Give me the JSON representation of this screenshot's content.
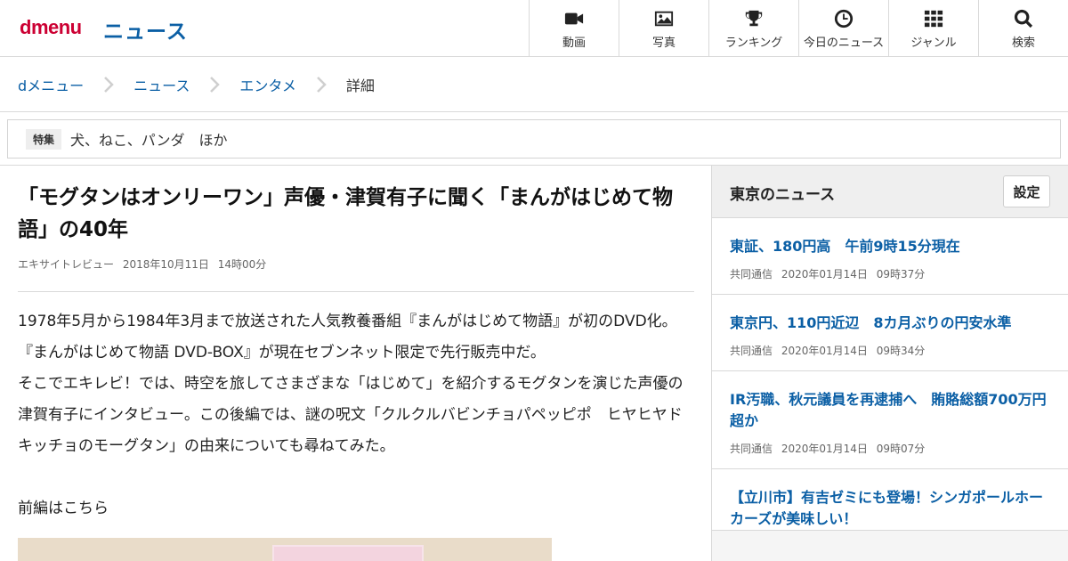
{
  "header": {
    "logo": "dmenu",
    "section_title": "ニュース",
    "nav": [
      {
        "label": "動画",
        "icon": "video-camera-icon"
      },
      {
        "label": "写真",
        "icon": "photo-icon"
      },
      {
        "label": "ランキング",
        "icon": "trophy-icon"
      },
      {
        "label": "今日のニュース",
        "icon": "clock-icon"
      },
      {
        "label": "ジャンル",
        "icon": "grid-icon"
      },
      {
        "label": "検索",
        "icon": "search-icon"
      }
    ]
  },
  "breadcrumb": {
    "items": [
      "dメニュー",
      "ニュース",
      "エンタメ",
      "詳細"
    ]
  },
  "feature": {
    "tag": "特集",
    "text": "犬、ねこ、パンダ　ほか"
  },
  "article": {
    "title": "「モグタンはオンリーワン」声優・津賀有子に聞く「まんがはじめて物語」の40年",
    "source": "エキサイトレビュー",
    "date": "2018年10月11日",
    "time": "14時00分",
    "paragraphs": [
      "1978年5月から1984年3月まで放送された人気教養番組『まんがはじめて物語』が初のDVD化。『まんがはじめて物語 DVD-BOX』が現在セブンネット限定で先行販売中だ。",
      "そこでエキレビ！では、時空を旅してさまざまな「はじめて」を紹介するモグタンを演じた声優の津賀有子にインタビュー。この後編では、謎の呪文「クルクルバビンチョパペッピポ　ヒヤヒヤドキッチョのモーグタン」の由来についても尋ねてみた。",
      "前編はこちら"
    ]
  },
  "sidebar": {
    "title": "東京のニュース",
    "settings_label": "設定",
    "news": [
      {
        "title": "東証、180円高　午前9時15分現在",
        "source": "共同通信",
        "date": "2020年01月14日",
        "time": "09時37分"
      },
      {
        "title": "東京円、110円近辺　8カ月ぶりの円安水準",
        "source": "共同通信",
        "date": "2020年01月14日",
        "time": "09時34分"
      },
      {
        "title": "IR汚職、秋元議員を再逮捕へ　賄賂総額700万円超か",
        "source": "共同通信",
        "date": "2020年01月14日",
        "time": "09時07分"
      },
      {
        "title": "【立川市】有吉ゼミにも登場！シンガポールホーカーズが美味しい！",
        "source": "",
        "date": "",
        "time": ""
      }
    ]
  },
  "colors": {
    "brand": "#cc0033",
    "link": "#0b5fa5"
  }
}
